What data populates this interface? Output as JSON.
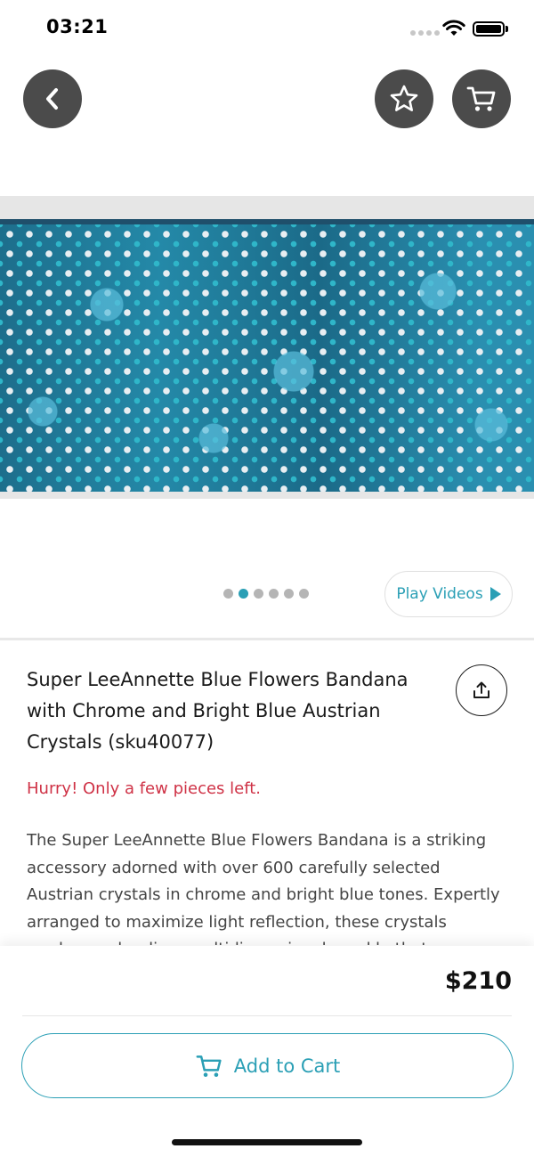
{
  "status_bar": {
    "time": "03:21"
  },
  "product": {
    "title": "Super LeeAnnette Blue Flowers Bandana with Chrome and Bright Blue Austrian Crystals (sku40077)",
    "stock_notice": "Hurry! Only a few pieces left.",
    "description": "The Super LeeAnnette Blue Flowers Bandana is a striking accessory adorned with over 600 carefully selected Austrian crystals in chrome and bright blue tones. Expertly arranged to maximize light reflection, these crystals produce a dazzling, multidimensional sparkle that",
    "price": "$210"
  },
  "gallery": {
    "total_images": 6,
    "active_index": 1,
    "play_videos_label": "Play Videos"
  },
  "actions": {
    "add_to_cart_label": "Add to Cart"
  },
  "icons": {
    "back": "chevron-left-icon",
    "favorite": "star-icon",
    "cart": "cart-icon",
    "share": "share-icon",
    "play": "play-icon"
  },
  "colors": {
    "accent": "#2a9fb5",
    "alert": "#cf3246",
    "nav_button": "#4b4b4b"
  }
}
